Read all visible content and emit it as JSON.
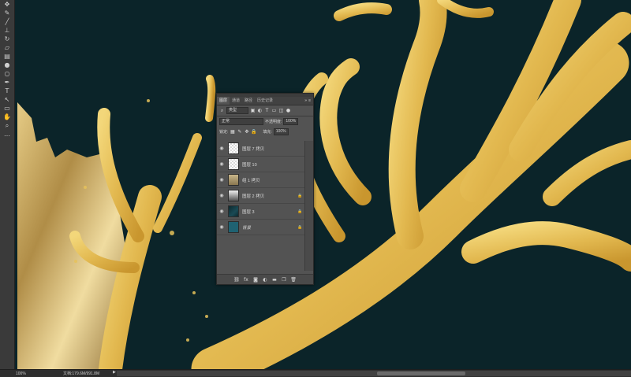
{
  "canvas": {
    "background_color": "#0b2429",
    "gold_color": "#e6c25a",
    "foil_color": "#c9a85c"
  },
  "toolbar": {
    "tools": [
      {
        "icon": "move-tool-icon",
        "glyph": "✥"
      },
      {
        "icon": "pen-tool-icon",
        "glyph": "✎"
      },
      {
        "icon": "brush-icon",
        "glyph": "╱"
      },
      {
        "icon": "stamp-icon",
        "glyph": "⊥"
      },
      {
        "icon": "history-brush-icon",
        "glyph": "↻"
      },
      {
        "icon": "eraser-icon",
        "glyph": "▱"
      },
      {
        "icon": "gradient-icon",
        "glyph": "▤"
      },
      {
        "icon": "blur-icon",
        "glyph": "●"
      },
      {
        "icon": "dodge-icon",
        "glyph": "○"
      },
      {
        "icon": "pen-icon",
        "glyph": "✒"
      },
      {
        "icon": "type-icon",
        "glyph": "T"
      },
      {
        "icon": "path-selection-icon",
        "glyph": "↖"
      },
      {
        "icon": "shape-icon",
        "glyph": "▭"
      },
      {
        "icon": "hand-icon",
        "glyph": "✋"
      },
      {
        "icon": "zoom-icon",
        "glyph": "⌕"
      },
      {
        "icon": "more-tools-icon",
        "glyph": "…"
      }
    ]
  },
  "layers_panel": {
    "tabs": [
      "图层",
      "通道",
      "路径",
      "历史记录"
    ],
    "active_tab": 0,
    "filter_kind": "类型",
    "blend_mode": "正常",
    "opacity_label": "不透明度:",
    "opacity_value": "100%",
    "lock_label": "锁定:",
    "fill_label": "填充:",
    "fill_value": "100%",
    "layers": [
      {
        "name": "图层 7 拷贝",
        "thumb": "checker",
        "locked": false,
        "italic": false
      },
      {
        "name": "图层 10",
        "thumb": "checker",
        "locked": false,
        "italic": false
      },
      {
        "name": "组 1 拷贝",
        "thumb": "photo",
        "locked": false,
        "italic": false
      },
      {
        "name": "图层 2 拷贝",
        "thumb": "gradient",
        "locked": true,
        "italic": false
      },
      {
        "name": "图层 3",
        "thumb": "dark",
        "locked": true,
        "italic": false
      },
      {
        "name": "背景",
        "thumb": "teal",
        "locked": true,
        "italic": true
      }
    ]
  },
  "status_bar": {
    "zoom": "100%",
    "doc_info": "文档:179.6M/991.8M"
  }
}
